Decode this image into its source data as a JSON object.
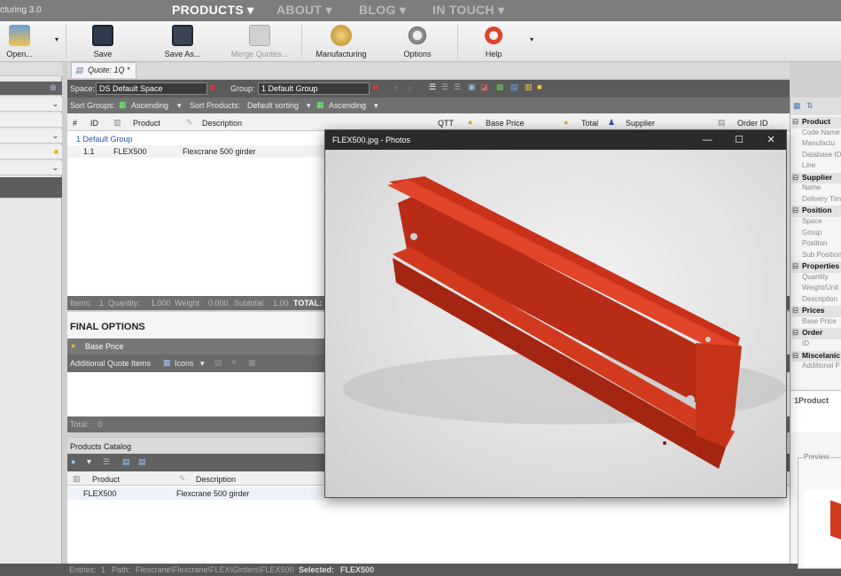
{
  "app": {
    "title_fragment": "cturing 3.0"
  },
  "nav": [
    {
      "label": "PRODUCTS ▾"
    },
    {
      "label": "ABOUT ▾"
    },
    {
      "label": "BLOG ▾"
    },
    {
      "label": "IN TOUCH ▾"
    }
  ],
  "toolbar": {
    "open": "Open...",
    "save": "Save",
    "save_as": "Save As...",
    "merge": "Merge Quotes...",
    "manufacturing": "Manufacturing",
    "options": "Options",
    "help": "Help"
  },
  "doc_tab": "Quote: 1Q *",
  "space_bar": {
    "space_label": "Space:",
    "space_value": "DS Default Space",
    "group_label": "Group:",
    "group_value": "1 Default Group"
  },
  "sort_bar": {
    "sort_groups_label": "Sort Groups:",
    "groups_order": "Ascending",
    "sort_products_label": "Sort Products:",
    "products_sort": "Default sorting",
    "products_order": "Ascending"
  },
  "grid": {
    "columns": {
      "hash": "#",
      "id": "ID",
      "product": "Product",
      "description": "Description",
      "qtt": "QTT",
      "base_price": "Base Price",
      "total": "Total",
      "supplier": "Supplier",
      "order_id": "Order ID"
    },
    "group_name": "1 Default Group",
    "rows": [
      {
        "num": "1.1",
        "product": "FLEX500",
        "description": "Flexcrane 500 girder"
      }
    ]
  },
  "status": {
    "items_label": "Items:",
    "items_val": "1",
    "qty_label": "Quantity:",
    "qty_val": "1.000",
    "weight_label": "Weight:",
    "weight_val": "0.000",
    "subtotal_label": "Subtotal:",
    "subtotal_val": "1.00",
    "total_label": "TOTAL:"
  },
  "final_options": {
    "title": "FINAL OPTIONS",
    "base_price": "Base Price"
  },
  "additional": {
    "label": "Additional Quote Items",
    "view": "Icons"
  },
  "total_bar": {
    "label": "Total:",
    "value": "0"
  },
  "catalog": {
    "title": "Products Catalog",
    "col_product": "Product",
    "col_description": "Description",
    "rows": [
      {
        "product": "FLEX500",
        "description": "Flexcrane 500 girder"
      }
    ]
  },
  "bottom_status": {
    "entries_label": "Entries:",
    "entries_val": "1",
    "path_label": "Path:",
    "path_val": "Flexcrane\\Flexcrane\\FLEX\\Girders\\FLEX500",
    "selected_label": "Selected:",
    "selected_val": "FLEX500"
  },
  "photo_window": {
    "title": "FLEX500.jpg - Photos",
    "minimize": "—",
    "maximize": "☐",
    "close": "✕"
  },
  "properties": {
    "items": [
      {
        "text": "Product",
        "cat": true
      },
      {
        "text": "Code Name"
      },
      {
        "text": "Manufactu"
      },
      {
        "text": "Database ID"
      },
      {
        "text": "Line"
      },
      {
        "text": "Supplier",
        "cat": true
      },
      {
        "text": "Name"
      },
      {
        "text": "Delivery Tim"
      },
      {
        "text": "Position",
        "cat": true
      },
      {
        "text": "Space"
      },
      {
        "text": "Group"
      },
      {
        "text": "Position"
      },
      {
        "text": "Sub Position"
      },
      {
        "text": "Properties",
        "cat": true
      },
      {
        "text": "Quantity"
      },
      {
        "text": "Weight/Unit"
      },
      {
        "text": "Description"
      },
      {
        "text": "Prices",
        "cat": true
      },
      {
        "text": "Base Price"
      },
      {
        "text": "Order",
        "cat": true
      },
      {
        "text": "ID"
      },
      {
        "text": "Miscelanic",
        "cat": true
      },
      {
        "text": "Additional P"
      }
    ],
    "footer": "1Product",
    "preview_label": "Preview"
  },
  "colors": {
    "accent_red": "#d23a1f",
    "nav_bg": "#7d7d7d",
    "dark_bar": "#5b5b5b"
  }
}
